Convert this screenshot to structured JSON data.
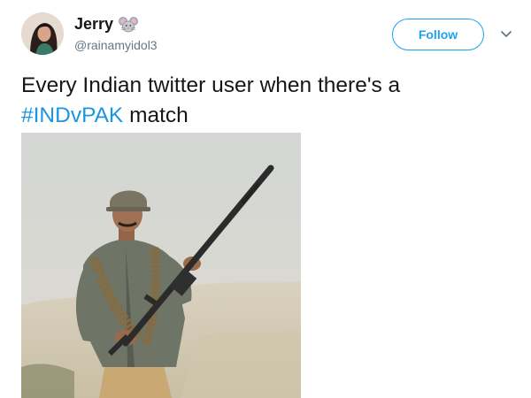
{
  "user": {
    "display_name": "Jerry",
    "handle": "@rainamyidol3",
    "name_emoji_icon": "mouse-face-icon"
  },
  "header": {
    "follow_label": "Follow",
    "caret_icon": "chevron-down-icon"
  },
  "tweet": {
    "text_line1": "Every Indian twitter user when there's a",
    "hashtag": "#INDvPAK",
    "text_after_hashtag": " match"
  },
  "colors": {
    "accent": "#1da1f2",
    "hashtag": "#1b95e0",
    "text": "#14171a",
    "secondary_text": "#657786"
  },
  "media": {
    "description_icon": "photo-soldier-with-gun"
  }
}
